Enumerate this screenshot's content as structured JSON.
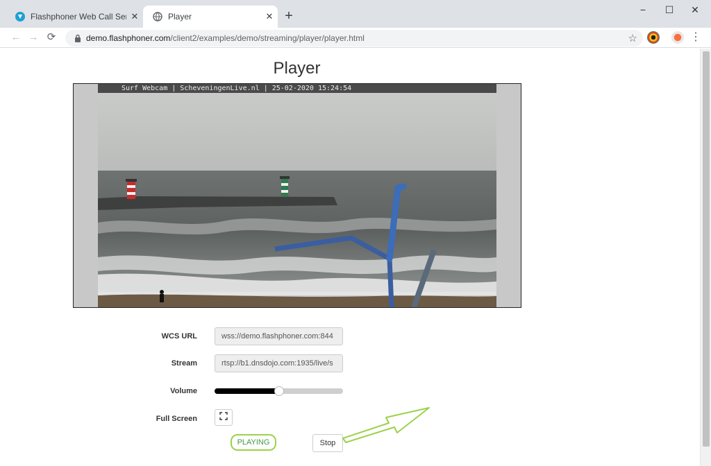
{
  "browser": {
    "tabs": [
      {
        "title": "Flashphoner Web Call Server",
        "active": false
      },
      {
        "title": "Player",
        "active": true
      }
    ],
    "new_tab_label": "+",
    "url_host": "demo.flashphoner.com",
    "url_path": "/client2/examples/demo/streaming/player/player.html",
    "window_controls": {
      "minimize": "−",
      "maximize": "☐",
      "close": "✕"
    }
  },
  "page": {
    "title": "Player",
    "video": {
      "overlay_text": "Surf Webcam | ScheveningenLive.nl | 25-02-2020 15:24:54"
    },
    "form": {
      "wcs_url_label": "WCS URL",
      "wcs_url_value": "wss://demo.flashphoner.com:844",
      "stream_label": "Stream",
      "stream_value": "rtsp://b1.dnsdojo.com:1935/live/s",
      "volume_label": "Volume",
      "volume_level": 0.5,
      "fullscreen_label": "Full Screen"
    },
    "status_text": "PLAYING",
    "stop_label": "Stop"
  },
  "colors": {
    "status_outline": "#9bd24a",
    "status_text": "#3c9a3c",
    "annotation_arrow": "#9bd24a"
  }
}
